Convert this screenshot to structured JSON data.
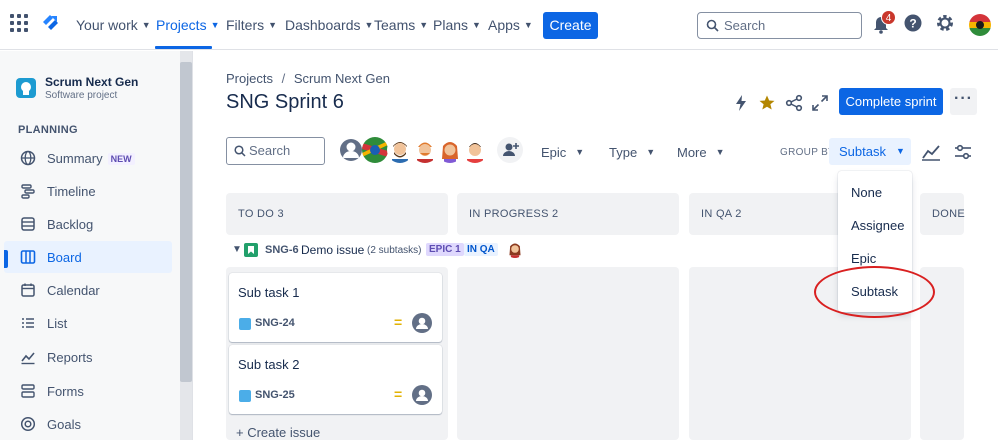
{
  "topbar": {
    "nav": [
      {
        "label": "Your work",
        "dropdown": true
      },
      {
        "label": "Projects",
        "dropdown": true,
        "active": true
      },
      {
        "label": "Filters",
        "dropdown": true
      },
      {
        "label": "Dashboards",
        "dropdown": true
      },
      {
        "label": "Teams",
        "dropdown": true
      },
      {
        "label": "Plans",
        "dropdown": true
      },
      {
        "label": "Apps",
        "dropdown": true
      }
    ],
    "create_label": "Create",
    "search_placeholder": "Search",
    "notification_count": "4"
  },
  "sidebar": {
    "project_name": "Scrum Next Gen",
    "project_type": "Software project",
    "section": "PLANNING",
    "items": [
      {
        "label": "Summary",
        "badge": "NEW",
        "icon": "globe-icon"
      },
      {
        "label": "Timeline",
        "icon": "timeline-icon"
      },
      {
        "label": "Backlog",
        "icon": "backlog-icon"
      },
      {
        "label": "Board",
        "icon": "board-icon",
        "active": true
      },
      {
        "label": "Calendar",
        "icon": "calendar-icon"
      },
      {
        "label": "List",
        "icon": "list-icon"
      },
      {
        "label": "Reports",
        "icon": "reports-icon"
      },
      {
        "label": "Forms",
        "icon": "forms-icon"
      },
      {
        "label": "Goals",
        "icon": "goals-icon"
      }
    ]
  },
  "header": {
    "breadcrumb": [
      "Projects",
      "Scrum Next Gen"
    ],
    "title": "SNG Sprint 6",
    "complete_label": "Complete sprint"
  },
  "toolbar": {
    "search_placeholder": "Search",
    "filters": [
      "Epic",
      "Type",
      "More"
    ],
    "group_by_label": "GROUP BY",
    "group_by_value": "Subtask"
  },
  "columns": [
    "TO DO 3",
    "IN PROGRESS 2",
    "IN QA 2",
    "DONE"
  ],
  "swimlane": {
    "key": "SNG-6",
    "name": "Demo issue",
    "subtasks": "(2 subtasks)",
    "epic": "EPIC 1",
    "status": "IN QA"
  },
  "cards": [
    {
      "title": "Sub task 1",
      "key": "SNG-24"
    },
    {
      "title": "Sub task 2",
      "key": "SNG-25"
    }
  ],
  "create_issue": "+ Create issue",
  "group_by_options": [
    "None",
    "Assignee",
    "Epic",
    "Subtask"
  ],
  "colors": {
    "accent": "#0c66e4",
    "annotation": "#d92020"
  }
}
